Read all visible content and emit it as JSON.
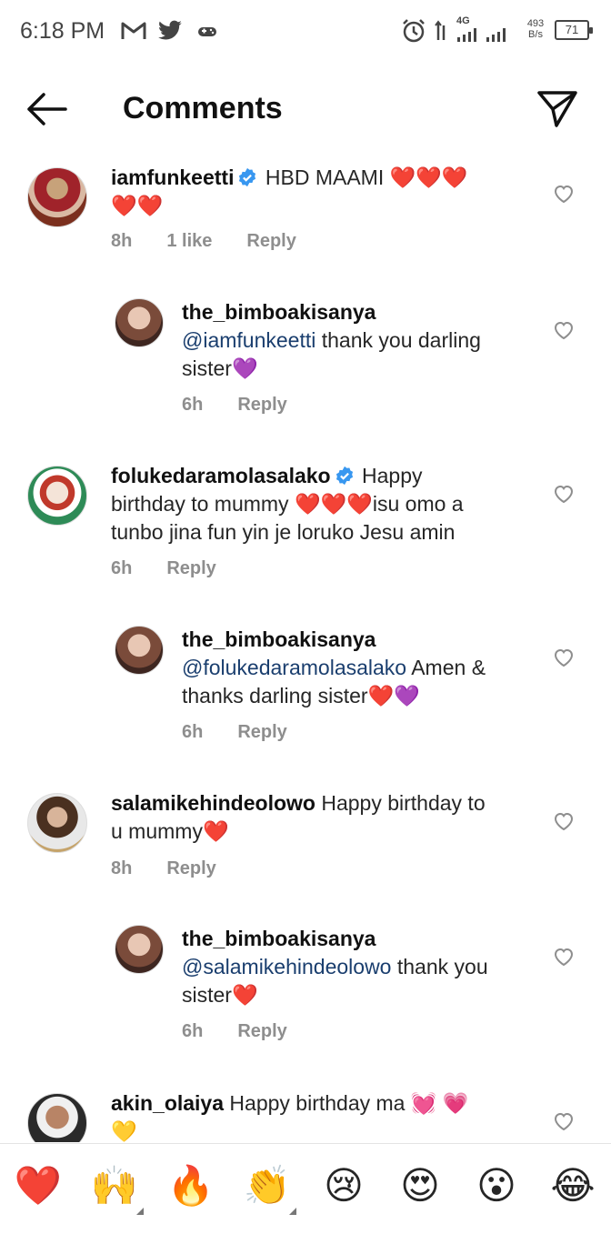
{
  "status_bar": {
    "time": "6:18 PM",
    "network": "4G",
    "speed_value": "493",
    "speed_unit": "B/s",
    "battery": "71"
  },
  "header": {
    "title": "Comments"
  },
  "comments": [
    {
      "user": "iamfunkeetti",
      "verified": true,
      "text_line1": "HBD MAAMI ❤️❤️❤️",
      "text_line2": "❤️❤️",
      "time": "8h",
      "likes": "1 like",
      "reply": "Reply"
    },
    {
      "user": "the_bimboakisanya",
      "mention": "@iamfunkeetti",
      "text": "thank you darling",
      "text_line2": "sister💜",
      "time": "6h",
      "reply": "Reply"
    },
    {
      "user": "folukedaramolasalako",
      "verified": true,
      "text_line1": "Happy",
      "text_line2": "birthday to mummy ❤️❤️❤️isu omo a",
      "text_line3": "tunbo jina fun yin je loruko Jesu amin",
      "time": "6h",
      "reply": "Reply"
    },
    {
      "user": "the_bimboakisanya",
      "mention": "@folukedaramolasalako",
      "text": "Amen &",
      "text_line2": "thanks darling sister❤️💜",
      "time": "6h",
      "reply": "Reply"
    },
    {
      "user": "salamikehindeolowo",
      "text_line1": "Happy birthday to",
      "text_line2": "u mummy❤️",
      "time": "8h",
      "reply": "Reply"
    },
    {
      "user": "the_bimboakisanya",
      "mention": "@salamikehindeolowo",
      "text": "thank you",
      "text_line2": "sister❤️",
      "time": "6h",
      "reply": "Reply"
    },
    {
      "user": "akin_olaiya",
      "text_line1": "Happy birthday ma 💓 💗",
      "text_line2": "💛"
    }
  ],
  "emoji_bar": [
    "❤️",
    "🙌",
    "🔥",
    "👏",
    "😢",
    "😍",
    "😮",
    "😂"
  ],
  "colors": {
    "verified": "#3897f0",
    "mention": "#1a3e6e",
    "meta": "#8e8e8e"
  }
}
